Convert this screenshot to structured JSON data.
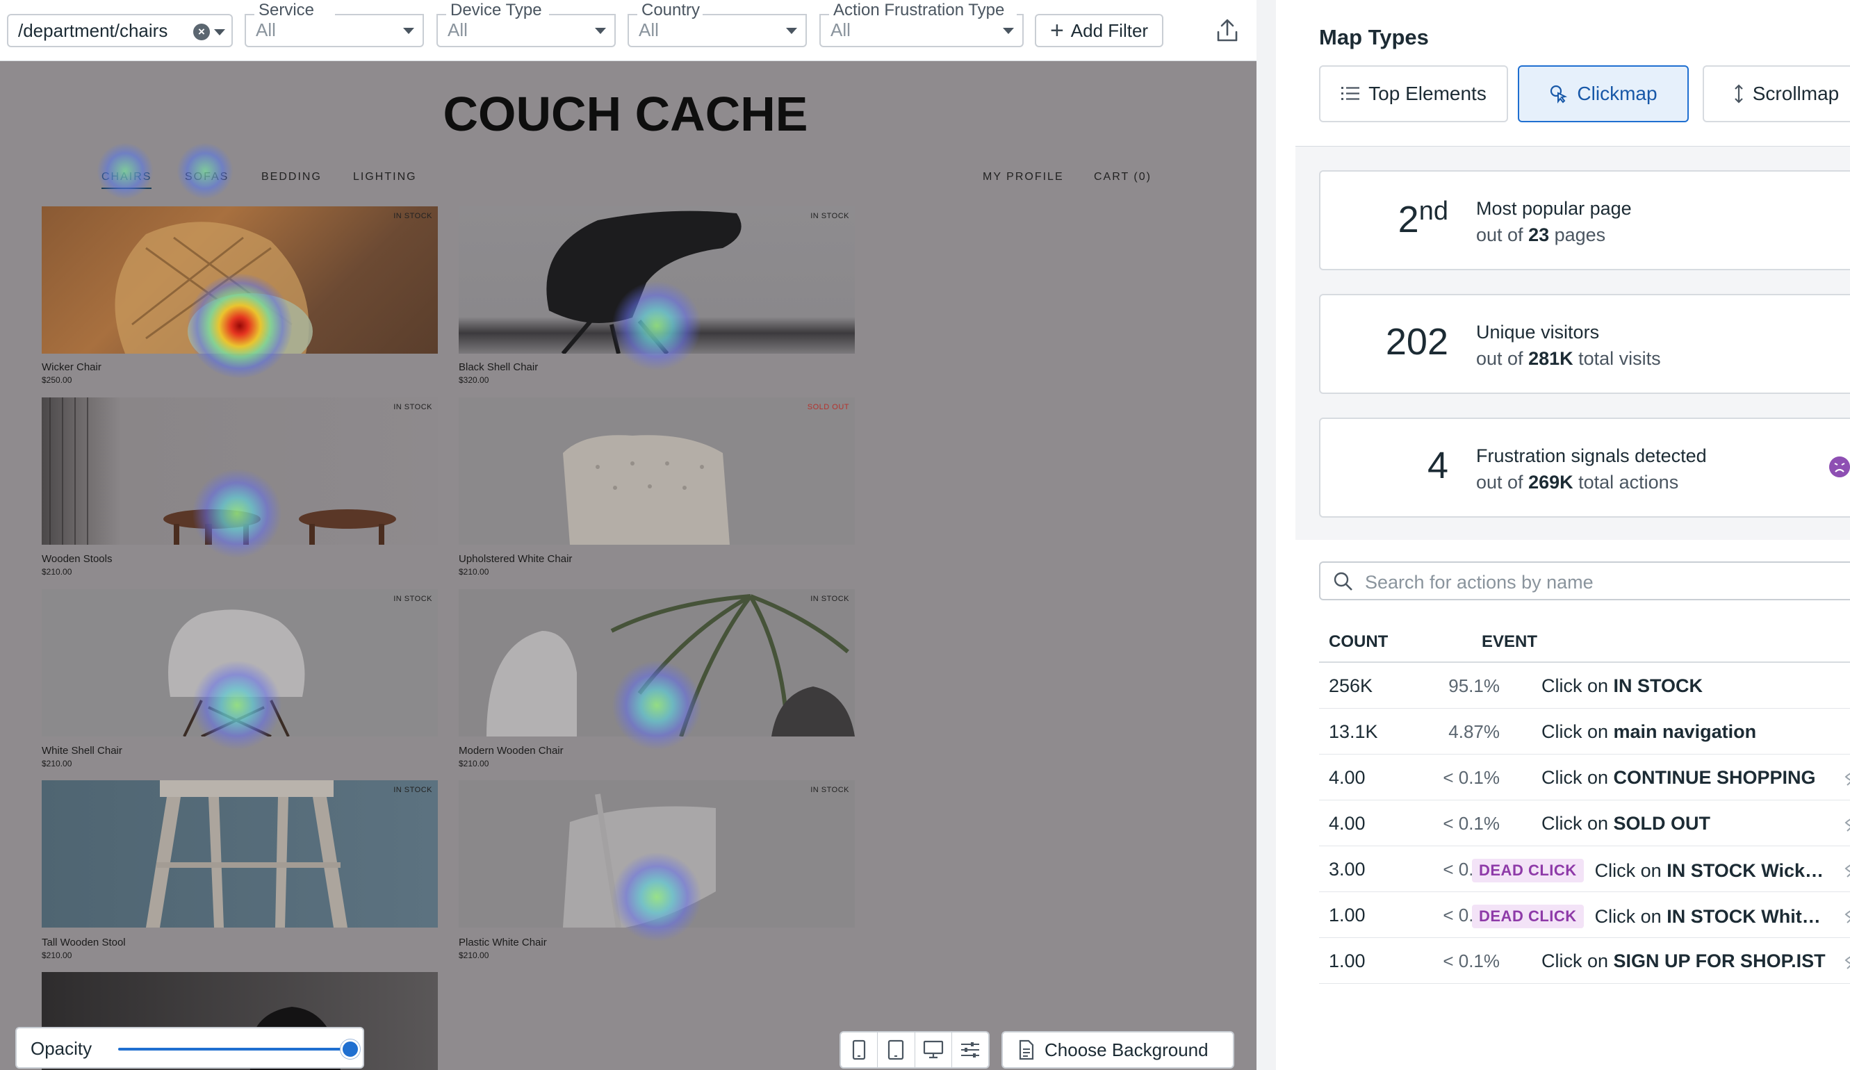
{
  "filters": {
    "page_path": "/department/chairs",
    "service": {
      "label": "Service",
      "value": "All"
    },
    "device_type": {
      "label": "Device Type",
      "value": "All"
    },
    "country": {
      "label": "Country",
      "value": "All"
    },
    "action_frustration": {
      "label": "Action Frustration Type",
      "value": "All"
    },
    "add_filter_label": "Add Filter"
  },
  "site": {
    "brand": "COUCH CACHE",
    "nav": [
      "CHAIRS",
      "SOFAS",
      "BEDDING",
      "LIGHTING"
    ],
    "nav_right": [
      "MY PROFILE",
      "CART (0)"
    ],
    "products": [
      {
        "name": "Wicker Chair",
        "price": "$250.00",
        "badge": "IN STOCK"
      },
      {
        "name": "Black Shell Chair",
        "price": "$320.00",
        "badge": "IN STOCK"
      },
      {
        "name": "Wooden Stools",
        "price": "$210.00",
        "badge": "IN STOCK"
      },
      {
        "name": "Upholstered White Chair",
        "price": "$210.00",
        "badge": "SOLD OUT"
      },
      {
        "name": "White Shell Chair",
        "price": "$210.00",
        "badge": "IN STOCK"
      },
      {
        "name": "Modern Wooden Chair",
        "price": "$210.00",
        "badge": "IN STOCK"
      },
      {
        "name": "Tall Wooden Stool",
        "price": "$210.00",
        "badge": "IN STOCK"
      },
      {
        "name": "Plastic White Chair",
        "price": "$210.00",
        "badge": "IN STOCK"
      }
    ]
  },
  "tools": {
    "opacity_label": "Opacity",
    "opacity_value": 1.0,
    "choose_background_label": "Choose Background"
  },
  "panel": {
    "title": "Map Types",
    "tabs": [
      "Top Elements",
      "Clickmap",
      "Scrollmap"
    ],
    "selected_tab": "Clickmap",
    "stats": [
      {
        "value": "2",
        "suffix": "nd",
        "line1": "Most popular page",
        "line2_pre": "out of ",
        "line2_bold": "23",
        "line2_post": " pages"
      },
      {
        "value": "202",
        "suffix": "",
        "line1": "Unique visitors",
        "line2_pre": "out of ",
        "line2_bold": "281K",
        "line2_post": " total visits"
      },
      {
        "value": "4",
        "suffix": "",
        "line1": "Frustration signals detected",
        "line2_pre": "out of ",
        "line2_bold": "269K",
        "line2_post": " total actions"
      }
    ],
    "search_placeholder": "Search for actions by name",
    "columns": [
      "COUNT",
      "EVENT"
    ],
    "rows": [
      {
        "count": "256K",
        "pct": "95.1%",
        "tag": "",
        "pre": "Click on ",
        "target": "IN STOCK",
        "hidden_icon": false
      },
      {
        "count": "13.1K",
        "pct": "4.87%",
        "tag": "",
        "pre": "Click on ",
        "target": "main navigation",
        "hidden_icon": false
      },
      {
        "count": "4.00",
        "pct": "< 0.1%",
        "tag": "",
        "pre": "Click on ",
        "target": "CONTINUE SHOPPING",
        "hidden_icon": true
      },
      {
        "count": "4.00",
        "pct": "< 0.1%",
        "tag": "",
        "pre": "Click on ",
        "target": "SOLD OUT",
        "hidden_icon": true
      },
      {
        "count": "3.00",
        "pct": "< 0.1%",
        "tag": "DEAD CLICK",
        "pre": "Click on ",
        "target": "IN STOCK Wick…",
        "hidden_icon": true
      },
      {
        "count": "1.00",
        "pct": "< 0.1%",
        "tag": "DEAD CLICK",
        "pre": "Click on ",
        "target": "IN STOCK Whit…",
        "hidden_icon": true
      },
      {
        "count": "1.00",
        "pct": "< 0.1%",
        "tag": "",
        "pre": "Click on ",
        "target": "SIGN UP FOR SHOP.IST",
        "hidden_icon": true
      }
    ]
  },
  "colors": {
    "accent": "#1f6fd0",
    "frustration": "#8e4fb3",
    "dead_click_bg": "#f3e3f7",
    "dead_click_fg": "#8e3aa8"
  }
}
